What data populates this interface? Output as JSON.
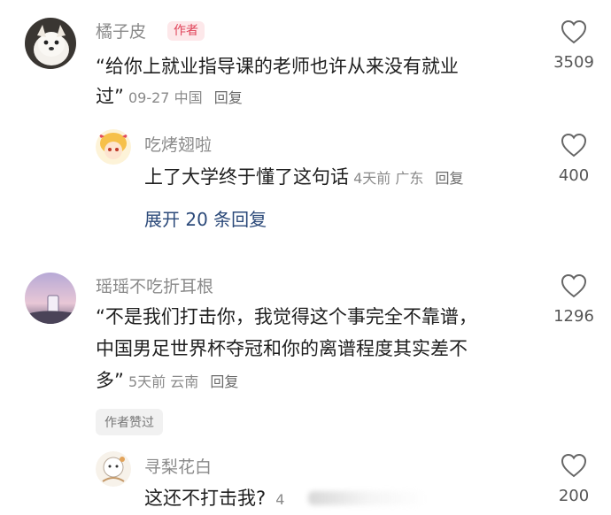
{
  "comments": [
    {
      "user": "橘子皮",
      "badge": "作者",
      "text_line1": "“给你上就业指导课的老师也许从来没有就业",
      "text_line2": "过”",
      "date": "09-27",
      "location": "中国",
      "reply_label": "回复",
      "likes": "3509"
    },
    {
      "user": "瑶瑶不吃折耳根",
      "text_line1": "“不是我们打击你，我觉得这个事完全不靠谱，",
      "text_line2": "中国男足世界杯夺冠和你的离谱程度其实差不",
      "text_line3": "多”",
      "date": "5天前",
      "location": "云南",
      "reply_label": "回复",
      "likes": "1296",
      "author_liked": "作者赞过"
    }
  ],
  "replies": [
    {
      "user": "吃烤翅啦",
      "text": "上了大学终于懂了这句话",
      "date": "4天前",
      "location": "广东",
      "reply_label": "回复",
      "likes": "400"
    },
    {
      "user": "寻梨花白",
      "text": "这还不打击我?",
      "date_partial": "4",
      "likes": "200"
    }
  ],
  "expand_label": "展开 20 条回复",
  "icons": {
    "like": "heart-outline-icon"
  },
  "colors": {
    "author_badge": "#e0445a",
    "link": "#2c4a7a"
  }
}
